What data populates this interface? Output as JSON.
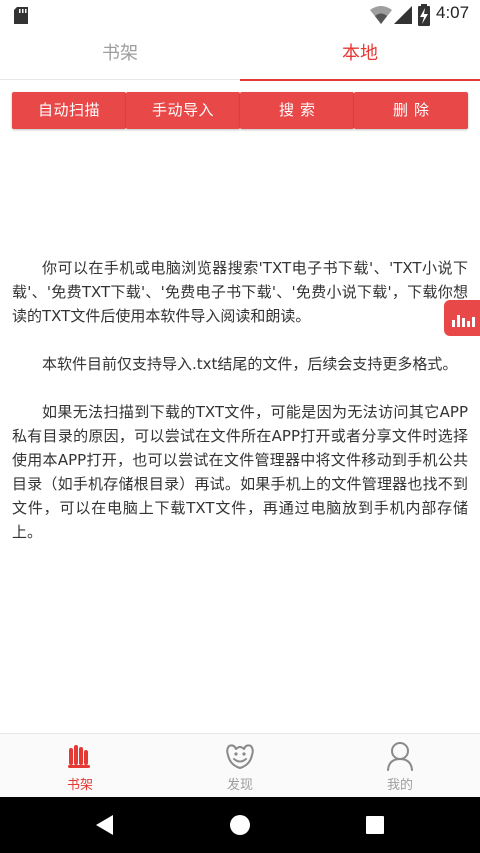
{
  "status_bar": {
    "time": "4:07",
    "icons": [
      "sd-card-icon",
      "wifi-icon",
      "signal-icon",
      "battery-charging-icon"
    ]
  },
  "top_tabs": [
    {
      "label": "书架",
      "active": false
    },
    {
      "label": "本地",
      "active": true
    }
  ],
  "actions": {
    "auto_scan": "自动扫描",
    "manual_import": "手动导入",
    "search": "搜索",
    "delete": "删除"
  },
  "content": {
    "paragraphs": [
      "你可以在手机或电脑浏览器搜索'TXT电子书下载'、'TXT小说下载'、'免费TXT下载'、'免费电子书下载'、'免费小说下载'，下载你想读的TXT文件后使用本软件导入阅读和朗读。",
      "本软件目前仅支持导入.txt结尾的文件，后续会支持更多格式。",
      "如果无法扫描到下载的TXT文件，可能是因为无法访问其它APP私有目录的原因，可以尝试在文件所在APP打开或者分享文件时选择使用本APP打开，也可以尝试在文件管理器中将文件移动到手机公共目录（如手机存储根目录）再试。如果手机上的文件管理器也找不到文件，可以在电脑上下载TXT文件，再通过电脑放到手机内部存储上。"
    ]
  },
  "bottom_nav": [
    {
      "label": "书架",
      "icon": "bookshelf-icon",
      "active": true
    },
    {
      "label": "发现",
      "icon": "discover-icon",
      "active": false
    },
    {
      "label": "我的",
      "icon": "profile-icon",
      "active": false
    }
  ],
  "colors": {
    "accent": "#e53935",
    "button": "#e84848",
    "inactive": "#9e9e9e"
  }
}
